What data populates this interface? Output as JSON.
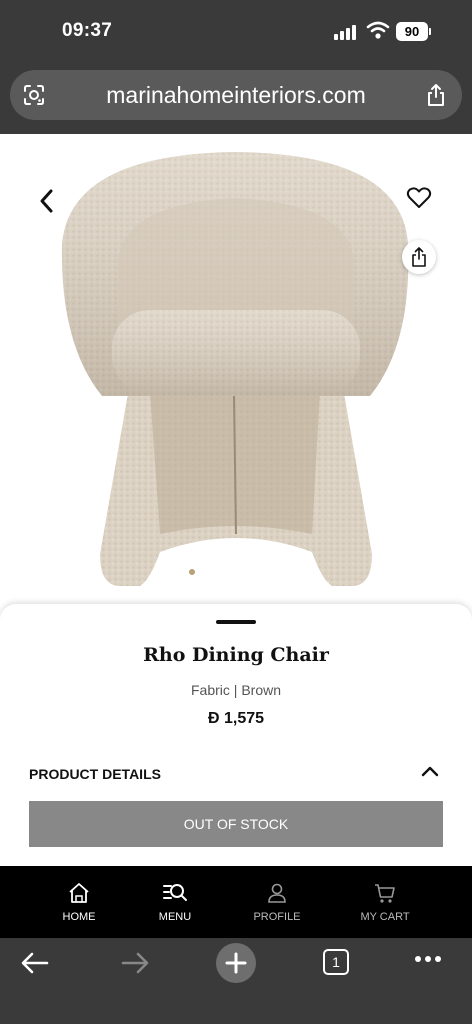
{
  "status": {
    "time": "09:37",
    "battery": "90"
  },
  "browser": {
    "url": "marinahomeinteriors.com",
    "tab_count": "1"
  },
  "product": {
    "name": "Rho Dining Chair",
    "variant": "Fabric | Brown",
    "price": "Đ 1,575",
    "details_label": "PRODUCT DETAILS",
    "stock_button": "OUT OF STOCK",
    "image_dots": 1,
    "active_dot": 0
  },
  "nav": [
    {
      "label": "HOME",
      "icon": "home-icon"
    },
    {
      "label": "MENU",
      "icon": "menu-search-icon"
    },
    {
      "label": "PROFILE",
      "icon": "profile-icon"
    },
    {
      "label": "MY CART",
      "icon": "cart-icon"
    }
  ],
  "colors": {
    "chair_fabric": "#ddd3c4",
    "button_disabled": "#888888",
    "chrome": "#3a3a3a"
  }
}
